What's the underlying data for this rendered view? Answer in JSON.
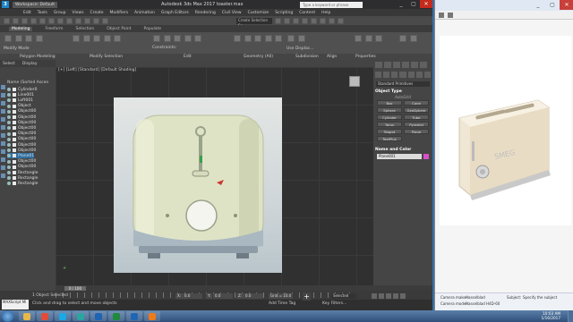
{
  "max": {
    "titlebar": {
      "app_icon": "3ds-max-logo",
      "workspace": "Workspace: Default",
      "title": "Autodesk 3ds Max 2017   toaster.max",
      "search_placeholder": "Type a keyword or phrase",
      "minimize": "_",
      "maximize": "▢",
      "close": "✕"
    },
    "menu": [
      "Edit",
      "Tools",
      "Group",
      "Views",
      "Create",
      "Modifiers",
      "Animation",
      "Graph Editors",
      "Rendering",
      "Civil View",
      "Customize",
      "Scripting",
      "Content",
      "Help"
    ],
    "quick_toolbar": {
      "selection_set": "Create Selection Se"
    },
    "ribbon_tabs": [
      "Modeling",
      "Freeform",
      "Selection",
      "Object Paint",
      "Populate"
    ],
    "ribbon_groups": [
      "Polygon Modeling",
      "Modify Selection",
      "Edit",
      "Geometry (All)",
      "Subdivision",
      "Align",
      "Properties"
    ],
    "ribbon_text": {
      "modify_mode": "Modify Mode",
      "constraints": "Constraints:",
      "use_displace": "Use Displac..."
    },
    "scene_explorer": {
      "tabs": [
        "Select",
        "Display"
      ],
      "header": "Name (Sorted Ascen",
      "items": [
        "Cylinder0",
        "Line001",
        "Loft001",
        "Object",
        "Object00",
        "Object00",
        "Object00",
        "Object00",
        "Object00",
        "Object00",
        "Object00",
        "Object00",
        "Plane01",
        "Object00",
        "Object00",
        "Rectangle",
        "Rectangle",
        "Rectangle"
      ],
      "selected_index": 12
    },
    "viewport": {
      "label": "[+] [Left] [Standard] [Default Shading]"
    },
    "command_panel": {
      "category": "Standard Primitives",
      "object_type_title": "Object Type",
      "autogrid": "AutoGrid",
      "buttons": [
        "Box",
        "Cone",
        "Sphere",
        "GeoSphere",
        "Cylinder",
        "Tube",
        "Torus",
        "Pyramid",
        "Teapot",
        "Plane",
        "TextPlus"
      ],
      "name_color_title": "Name and Color",
      "object_name": "Plane001",
      "object_color": "#d850c8"
    },
    "timeline": {
      "slider": "0 / 100"
    },
    "status": {
      "script_box": "MAXScript Mi",
      "objects_selected": "1 Object Selected",
      "prompt": "Click and drag to select and move objects",
      "x_label": "X:",
      "x_value": "0.0",
      "y_label": "Y:",
      "y_value": "0.0",
      "z_label": "Z:",
      "z_value": "0.0",
      "grid": "Grid = 10.0",
      "add_time_tag": "Add Time Tag",
      "key_mode": "Selected",
      "key_filters": "Key Filters..."
    }
  },
  "photo_viewer": {
    "camera_maker_label": "Camera maker:",
    "camera_maker": "Hasselblad",
    "camera_model_label": "Camera model:",
    "camera_model": "Hasselblad H4D-60",
    "subject_label": "Subject:",
    "subject": "Specify the subject"
  },
  "taskbar": {
    "apps": [
      "explorer",
      "chrome",
      "skype",
      "3ds-max",
      "photoshop",
      "excel",
      "outlook",
      "media-player"
    ],
    "app_colors": [
      "#e8b84a",
      "#e34c3a",
      "#19a9e5",
      "#2aa5a0",
      "#1f63b3",
      "#1f8a3b",
      "#1e66b5",
      "#ef7a1a"
    ],
    "time": "10:03 AM",
    "date": "1/16/2017"
  }
}
